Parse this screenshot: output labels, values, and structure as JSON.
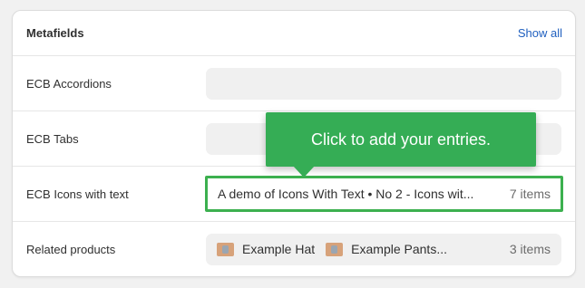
{
  "metafields": {
    "title": "Metafields",
    "show_all_label": "Show all",
    "rows": [
      {
        "label": "ECB Accordions",
        "value": "",
        "count": ""
      },
      {
        "label": "ECB Tabs",
        "value": "",
        "count": ""
      },
      {
        "label": "ECB Icons with text",
        "value": "A demo of Icons With Text • No 2 - Icons wit...",
        "count": "7 items"
      },
      {
        "label": "Related products",
        "products": [
          "Example Hat",
          "Example Pants..."
        ],
        "count": "3 items"
      }
    ]
  },
  "tooltip": {
    "text": "Click to add your entries."
  },
  "colors": {
    "accent_green": "#35ad55",
    "highlight_border": "#3cb04f",
    "link_blue": "#1f5fbf"
  },
  "icons": [
    "product-thumbnail-icon"
  ]
}
